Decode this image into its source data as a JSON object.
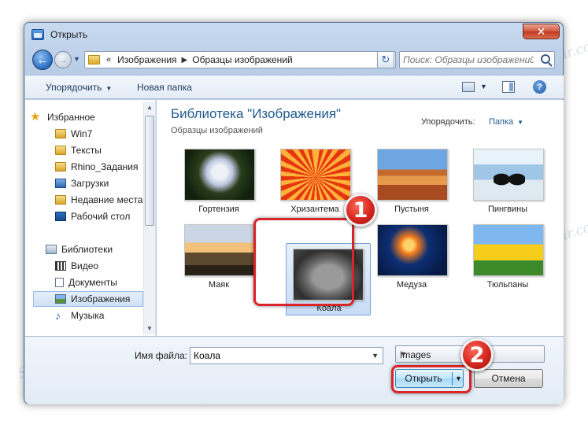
{
  "window": {
    "title": "Открыть",
    "close_symbol": "✕"
  },
  "nav": {
    "back_icon": "arrow-left-icon",
    "breadcrumb": [
      "Изображения",
      "Образцы изображений"
    ],
    "breadcrumb_prefix": "«",
    "search_placeholder": "Поиск: Образцы изображений"
  },
  "toolbar": {
    "organize": "Упорядочить",
    "new_folder": "Новая папка",
    "help": "?"
  },
  "sidebar": {
    "favorites": "Избранное",
    "fav_items": [
      "Win7",
      "Тексты",
      "Rhino_Задания",
      "Загрузки",
      "Недавние места",
      "Рабочий стол"
    ],
    "libraries": "Библиотеки",
    "lib_items": [
      "Видео",
      "Документы",
      "Изображения",
      "Музыка"
    ],
    "selected": "Изображения"
  },
  "content": {
    "library_title": "Библиотека \"Изображения\"",
    "library_subtitle": "Образцы изображений",
    "arrange_label": "Упорядочить:",
    "arrange_value": "Папка",
    "files": [
      "Гортензия",
      "Хризантема",
      "Пустыня",
      "Пингвины",
      "Маяк",
      "Коала",
      "Медуза",
      "Тюльпаны"
    ],
    "selected_file": "Коала"
  },
  "bottom": {
    "filename_label": "Имя файла:",
    "filename_value": "Коала",
    "filetype": "Images",
    "open_label": "Открыть",
    "cancel_label": "Отмена"
  },
  "annotations": {
    "step1": "1",
    "step2": "2",
    "color": "#d8252a"
  },
  "watermark": "Soringpcrepair.com"
}
